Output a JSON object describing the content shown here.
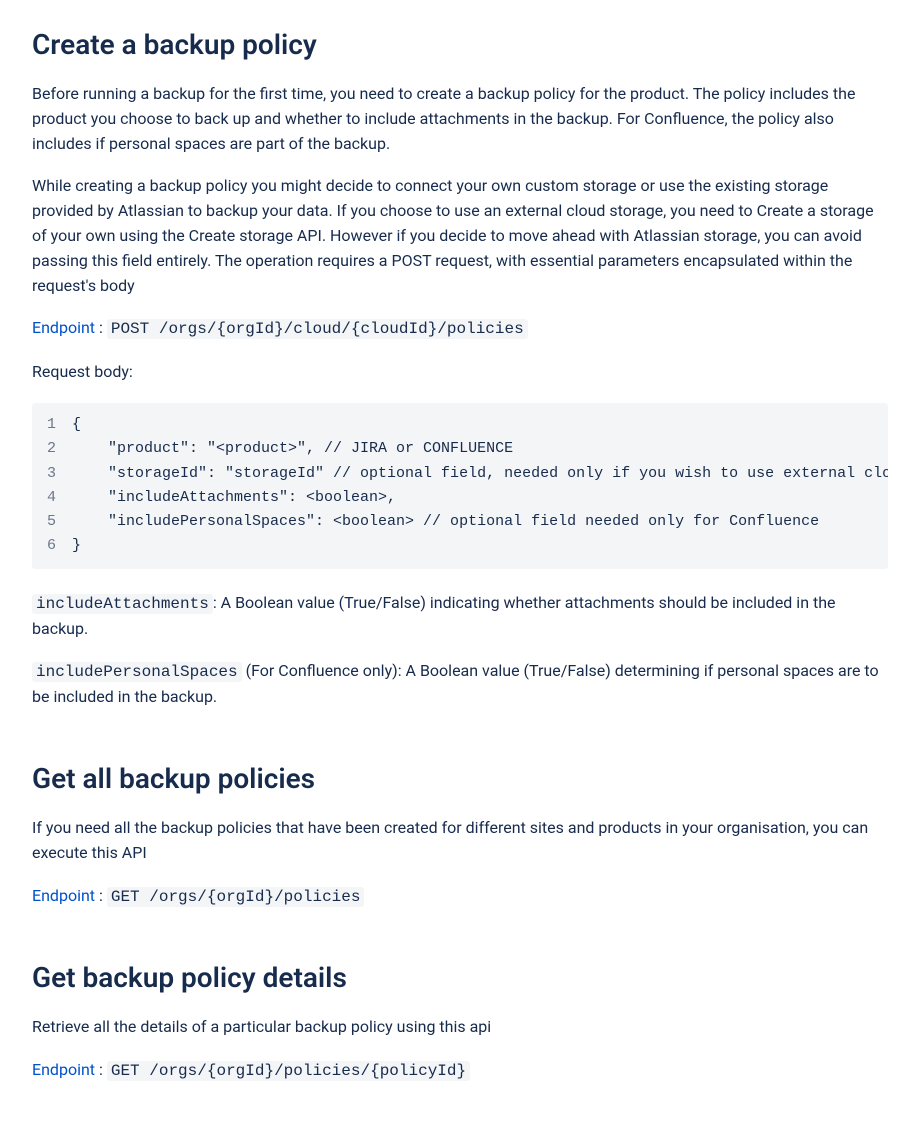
{
  "section1": {
    "heading": "Create a backup policy",
    "para1": "Before running a backup for the first time, you need to create a backup policy for the product. The policy includes the product you choose to back up and whether to include attachments in the backup. For Confluence, the policy also includes if personal spaces are part of the backup.",
    "para2": "While creating a backup policy you might decide to connect your own custom storage or use the existing storage provided by Atlassian to backup your data. If you choose to use an external cloud storage, you need to Create a storage of your own using the Create storage API. However if you decide to move ahead with Atlassian storage, you can avoid passing this field entirely. The operation requires a POST request, with essential parameters encapsulated within the request's body",
    "endpointLabel": "Endpoint",
    "endpointColon": " :",
    "endpointCode": "POST /orgs/{orgId}/cloud/{cloudId}/policies",
    "requestBodyLabel": "Request body:",
    "code": {
      "lineNums": [
        "1",
        "2",
        "3",
        "4",
        "5",
        "6"
      ],
      "l1": "{",
      "l2": "    \"product\": \"<product>\", // JIRA or CONFLUENCE",
      "l3": "    \"storageId\": \"storageId\" // optional field, needed only if you wish to use external cloud s",
      "l4": "    \"includeAttachments\": <boolean>,",
      "l5": "    \"includePersonalSpaces\": <boolean> // optional field needed only for Confluence",
      "l6": "}"
    },
    "attField": "includeAttachments",
    "attDesc": ": A Boolean value (True/False) indicating whether attachments should be included in the backup.",
    "spacesField": "includePersonalSpaces",
    "spacesDesc": " (For Confluence only): A Boolean value (True/False) determining if personal spaces are to be included in the backup."
  },
  "section2": {
    "heading": "Get all backup policies",
    "para1": "If you need all the backup policies that have been created for different sites and products in your organisation, you can execute this API",
    "endpointLabel": "Endpoint",
    "endpointColon": " :",
    "endpointCode": "GET /orgs/{orgId}/policies"
  },
  "section3": {
    "heading": "Get backup policy details",
    "para1": "Retrieve all the details of a particular backup policy using this api",
    "endpointLabel": "Endpoint",
    "endpointColon": " :",
    "endpointCode": "GET /orgs/{orgId}/policies/{policyId}"
  }
}
